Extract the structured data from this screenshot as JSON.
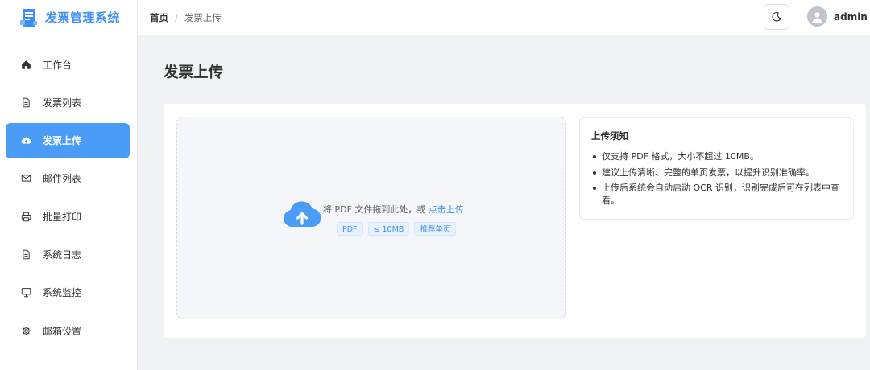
{
  "app": {
    "name": "发票管理系统"
  },
  "sidebar": {
    "items": [
      {
        "label": "工作台",
        "icon": "home-icon"
      },
      {
        "label": "发票列表",
        "icon": "document-icon"
      },
      {
        "label": "发票上传",
        "icon": "cloud-upload-icon",
        "active": true
      },
      {
        "label": "邮件列表",
        "icon": "mail-icon"
      },
      {
        "label": "批量打印",
        "icon": "printer-icon"
      },
      {
        "label": "系统日志",
        "icon": "document-icon"
      },
      {
        "label": "系统监控",
        "icon": "monitor-icon"
      },
      {
        "label": "邮箱设置",
        "icon": "gear-icon"
      }
    ]
  },
  "header": {
    "breadcrumb": {
      "home": "首页",
      "separator": "/",
      "current": "发票上传"
    },
    "theme_icon": "moon-icon",
    "user": {
      "name": "admin"
    }
  },
  "main": {
    "title": "发票上传",
    "upload": {
      "text": "将 PDF 文件拖到此处，或",
      "link": "点击上传",
      "tags": [
        "PDF",
        "≤ 10MB",
        "推荐单页"
      ]
    },
    "notice": {
      "title": "上传须知",
      "items": [
        "仅支持 PDF 格式，大小不超过 10MB。",
        "建议上传清晰、完整的单页发票，以提升识别准确率。",
        "上传后系统会自动启动 OCR 识别，识别完成后可在列表中查看。"
      ]
    }
  },
  "colors": {
    "accent": "#4a9cf6",
    "link": "#3d8ef5",
    "background": "#f0f2f5"
  }
}
